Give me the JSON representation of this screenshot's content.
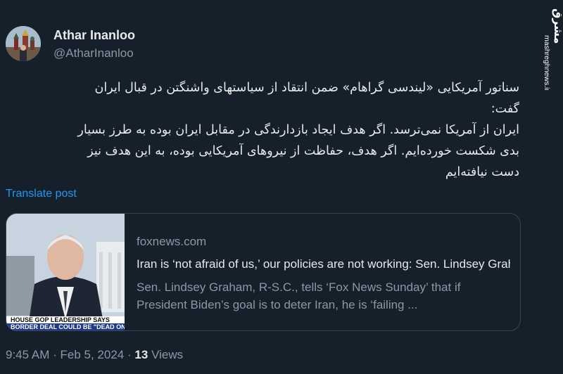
{
  "author": {
    "name": "Athar Inanloo",
    "handle": "@AtharInanloo"
  },
  "tweet": {
    "lines": [
      "سناتور آمریکایی «لیندسی گراهام» ضمن انتقاد از سیاستهای واشنگتن در قبال ایران",
      "گفت:",
      "ایران از آمریکا نمی‌ترسد. اگر هدف ایجاد بازدارندگی در مقابل ایران بوده به طرز بسیار",
      "بدی شکست خورده‌ایم. اگر هدف، حفاظت از نیروهای آمریکایی بوده، به این هدف نیز",
      "دست نیافته‌ایم"
    ],
    "translate_label": "Translate post"
  },
  "card": {
    "domain": "foxnews.com",
    "title": "Iran is ‘not afraid of us,’ our policies are not working: Sen. Lindsey Graham",
    "description_lines": [
      "Sen. Lindsey Graham, R-S.C., tells ‘Fox News Sunday’ that if",
      "President Biden’s goal is to deter Iran, he is ‘failing ..."
    ],
    "thumb_banner_lines": [
      "HOUSE GOP LEADERSHIP SAYS",
      "BORDER DEAL COULD BE \"DEAD ON"
    ]
  },
  "meta": {
    "time": "9:45 AM",
    "date": "Feb 5, 2024",
    "separator": "·",
    "views_count": "13",
    "views_label": "Views"
  },
  "watermark": {
    "logo_text": "مشرق",
    "url": "mashreghnews.ir"
  },
  "colors": {
    "background": "#15202b",
    "link": "#1d9bf0",
    "secondary_text": "#8b98a5",
    "border": "#38444d"
  }
}
